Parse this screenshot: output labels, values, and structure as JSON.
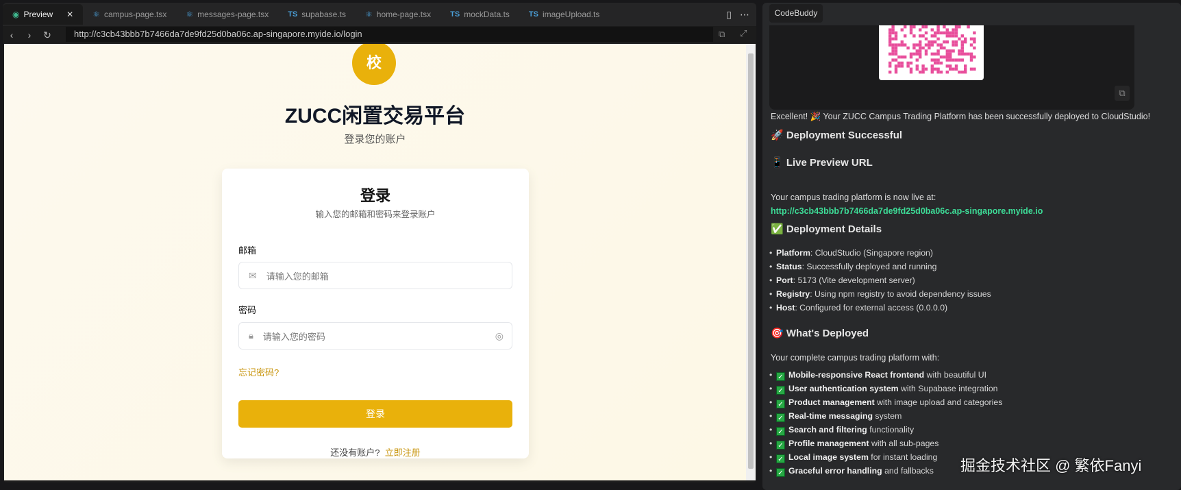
{
  "editor": {
    "tabs": [
      {
        "label": "Preview",
        "icon": "eye-icon"
      },
      {
        "label": "campus-page.tsx",
        "icon": "react-icon"
      },
      {
        "label": "messages-page.tsx",
        "icon": "react-icon"
      },
      {
        "label": "supabase.ts",
        "icon": "TS"
      },
      {
        "label": "home-page.tsx",
        "icon": "react-icon"
      },
      {
        "label": "mockData.ts",
        "icon": "TS"
      },
      {
        "label": "imageUpload.ts",
        "icon": "TS"
      }
    ],
    "ts_badge": "TS",
    "url": "http://c3cb43bbb7b7466da7de9fd25d0ba06c.ap-singapore.myide.io/login"
  },
  "login_page": {
    "logo_char": "校",
    "title": "ZUCC闲置交易平台",
    "subtitle": "登录您的账户",
    "card_title": "登录",
    "card_subtitle": "输入您的邮箱和密码来登录账户",
    "email_label": "邮箱",
    "email_placeholder": "请输入您的邮箱",
    "password_label": "密码",
    "password_placeholder": "请输入您的密码",
    "forgot": "忘记密码?",
    "submit": "登录",
    "no_account": "还没有账户?",
    "register": "立即注册",
    "accent": "#e9b10b"
  },
  "chat": {
    "tab": "CodeBuddy",
    "intro_pre": "Excellent! 🎉 Your ZUCC Campus Trading Platform has been successfully deployed to CloudStudio!",
    "h_success": "🚀 Deployment Successful",
    "h_live": "📱 Live Preview URL",
    "live_text": "Your campus trading platform is now live at:",
    "live_url": "http://c3cb43bbb7b7466da7de9fd25d0ba06c.ap-singapore.myide.io",
    "h_details": "✅ Deployment Details",
    "details": [
      {
        "k": "Platform",
        "v": ": CloudStudio (Singapore region)"
      },
      {
        "k": "Status",
        "v": ": Successfully deployed and running"
      },
      {
        "k": "Port",
        "v": ": 5173 (Vite development server)"
      },
      {
        "k": "Registry",
        "v": ": Using npm registry to avoid dependency issues"
      },
      {
        "k": "Host",
        "v": ": Configured for external access (0.0.0.0)"
      }
    ],
    "h_deployed": "🎯 What's Deployed",
    "deployed_text": "Your complete campus trading platform with:",
    "features": [
      {
        "k": "Mobile-responsive React frontend",
        "v": " with beautiful UI"
      },
      {
        "k": "User authentication system",
        "v": " with Supabase integration"
      },
      {
        "k": "Product management",
        "v": " with image upload and categories"
      },
      {
        "k": "Real-time messaging",
        "v": " system"
      },
      {
        "k": "Search and filtering",
        "v": " functionality"
      },
      {
        "k": "Profile management",
        "v": " with all sub-pages"
      },
      {
        "k": "Local image system",
        "v": " for instant loading"
      },
      {
        "k": "Graceful error handling",
        "v": " and fallbacks"
      }
    ],
    "check": "✓"
  },
  "watermark": "掘金技术社区 @ 繁依Fanyi"
}
